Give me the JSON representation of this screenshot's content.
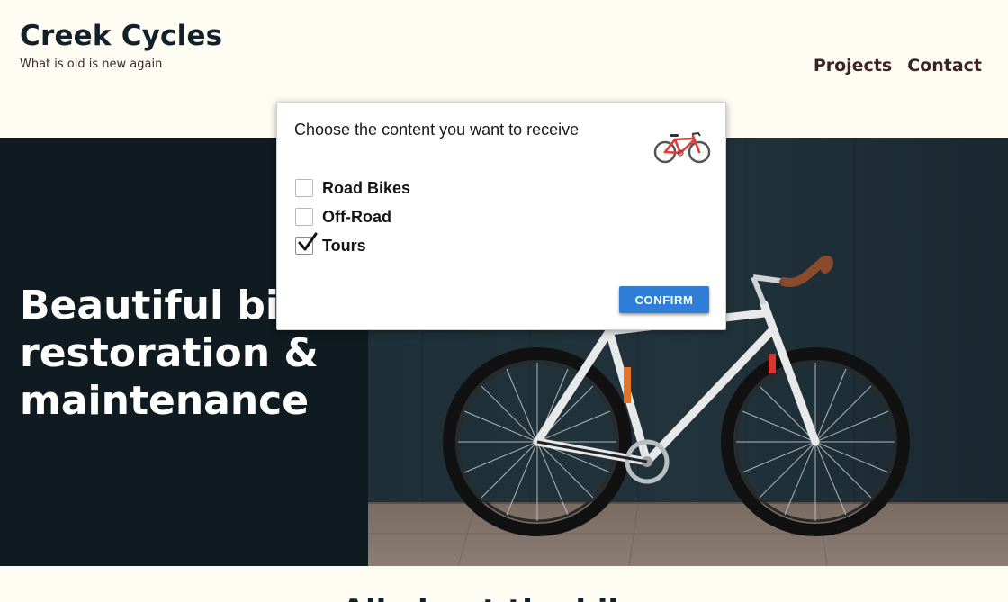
{
  "header": {
    "title": "Creek Cycles",
    "tagline": "What is old is new again",
    "nav": [
      {
        "label": "Projects"
      },
      {
        "label": "Contact"
      }
    ]
  },
  "hero": {
    "title_lines": [
      "Beautiful bike",
      "restoration &",
      "maintenance"
    ],
    "photo_icon": "bicycle-photo"
  },
  "next_section": {
    "title": "All about the bikes"
  },
  "dialog": {
    "heading": "Choose the content you want to receive",
    "icon": "red-bicycle-icon",
    "options": [
      {
        "label": "Road Bikes",
        "checked": false
      },
      {
        "label": "Off-Road",
        "checked": false
      },
      {
        "label": "Tours",
        "checked": true
      }
    ],
    "confirm_label": "CONFIRM"
  },
  "colors": {
    "page_bg": "#fffcf3",
    "hero_bg": "#0f1b20",
    "brand_text": "#12202a",
    "nav_text": "#3a2424",
    "button_blue": "#2f7fd8"
  }
}
